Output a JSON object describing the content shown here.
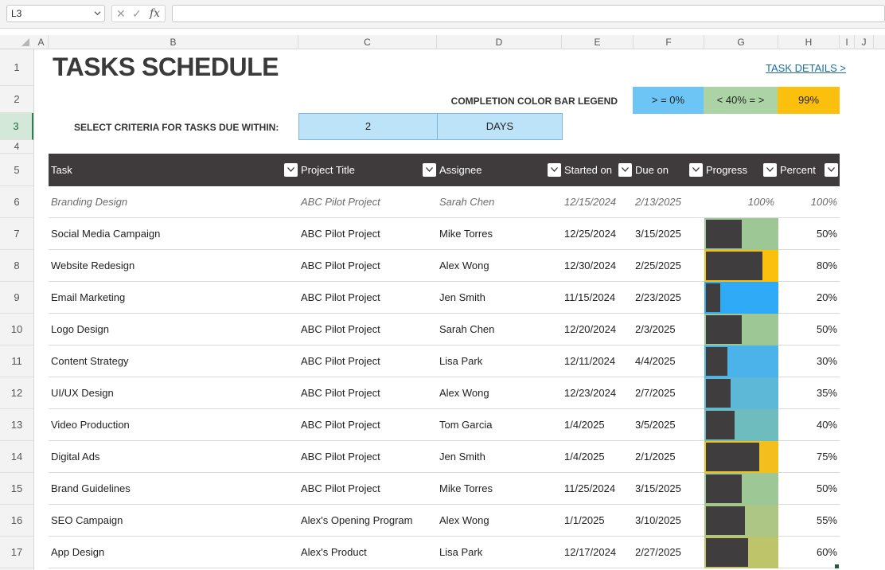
{
  "formula_bar": {
    "name_box": "L3",
    "cancel_icon": "✕",
    "enter_icon": "✓",
    "fx_label": "fx",
    "formula": ""
  },
  "columns": [
    "A",
    "B",
    "C",
    "D",
    "E",
    "F",
    "G",
    "H",
    "I",
    "J"
  ],
  "rows": [
    "1",
    "2",
    "3",
    "4",
    "5",
    "6",
    "7",
    "8",
    "9",
    "10",
    "11",
    "12",
    "13",
    "14",
    "15",
    "16",
    "17"
  ],
  "sheet": {
    "title": "TASKS SCHEDULE",
    "task_details_link": "TASK DETAILS >",
    "legend_label": "COMPLETION COLOR BAR LEGEND",
    "legend": [
      {
        "label": "> = 0%",
        "color": "#6cc5f5"
      },
      {
        "label": "< 40% = >",
        "color": "#acd3a6"
      },
      {
        "label": "99%",
        "color": "#fbbf0e"
      }
    ],
    "criteria_label": "SELECT CRITERIA FOR TASKS DUE WITHIN:",
    "criteria_value": "2",
    "criteria_unit": "DAYS"
  },
  "table": {
    "headers": [
      "Task",
      "Project Title",
      "Assignee",
      "Started on",
      "Due on",
      "Progress",
      "Percent"
    ],
    "rows": [
      {
        "task": "Branding Design",
        "project": "ABC Pilot Project",
        "assignee": "Sarah Chen",
        "started": "12/15/2024",
        "due": "2/13/2025",
        "progress": "100%",
        "percent": "100%",
        "style": "italic"
      },
      {
        "task": "Social Media Campaign",
        "project": "ABC Pilot Project",
        "assignee": "Mike Torres",
        "started": "12/25/2024",
        "due": "3/15/2025",
        "percent": "50%",
        "fraction": 0.5,
        "bar_color": "#9dc795"
      },
      {
        "task": "Website Redesign",
        "project": "ABC Pilot Project",
        "assignee": "Alex Wong",
        "started": "12/30/2024",
        "due": "2/25/2025",
        "percent": "80%",
        "fraction": 0.8,
        "bar_color": "#fbbf0e"
      },
      {
        "task": "Email Marketing",
        "project": "ABC Pilot Project",
        "assignee": "Jen Smith",
        "started": "11/15/2024",
        "due": "2/23/2025",
        "percent": "20%",
        "fraction": 0.2,
        "bar_color": "#2eaaf7"
      },
      {
        "task": "Logo Design",
        "project": "ABC Pilot Project",
        "assignee": "Sarah Chen",
        "started": "12/20/2024",
        "due": "2/3/2025",
        "percent": "50%",
        "fraction": 0.5,
        "bar_color": "#9dc795"
      },
      {
        "task": "Content Strategy",
        "project": "ABC Pilot Project",
        "assignee": "Lisa Park",
        "started": "12/11/2024",
        "due": "4/4/2025",
        "percent": "30%",
        "fraction": 0.3,
        "bar_color": "#4bb3ea"
      },
      {
        "task": "UI/UX Design",
        "project": "ABC Pilot Project",
        "assignee": "Alex Wong",
        "started": "12/23/2024",
        "due": "2/7/2025",
        "percent": "35%",
        "fraction": 0.35,
        "bar_color": "#5cb8d6"
      },
      {
        "task": "Video Production",
        "project": "ABC Pilot Project",
        "assignee": "Tom Garcia",
        "started": "1/4/2025",
        "due": "3/5/2025",
        "percent": "40%",
        "fraction": 0.4,
        "bar_color": "#6fbcbe"
      },
      {
        "task": "Digital Ads",
        "project": "ABC Pilot Project",
        "assignee": "Jen Smith",
        "started": "1/4/2025",
        "due": "2/1/2025",
        "percent": "75%",
        "fraction": 0.75,
        "bar_color": "#f4bf1c"
      },
      {
        "task": "Brand Guidelines",
        "project": "ABC Pilot Project",
        "assignee": "Mike Torres",
        "started": "11/25/2024",
        "due": "3/15/2025",
        "percent": "50%",
        "fraction": 0.5,
        "bar_color": "#9dc795"
      },
      {
        "task": "SEO Campaign",
        "project": "Alex's Opening Program",
        "assignee": "Alex Wong",
        "started": "1/1/2025",
        "due": "3/10/2025",
        "percent": "55%",
        "fraction": 0.55,
        "bar_color": "#adc585"
      },
      {
        "task": "App Design",
        "project": "Alex's Product",
        "assignee": "Lisa Park",
        "started": "12/17/2024",
        "due": "2/27/2025",
        "percent": "60%",
        "fraction": 0.6,
        "bar_color": "#bec46a"
      }
    ]
  }
}
